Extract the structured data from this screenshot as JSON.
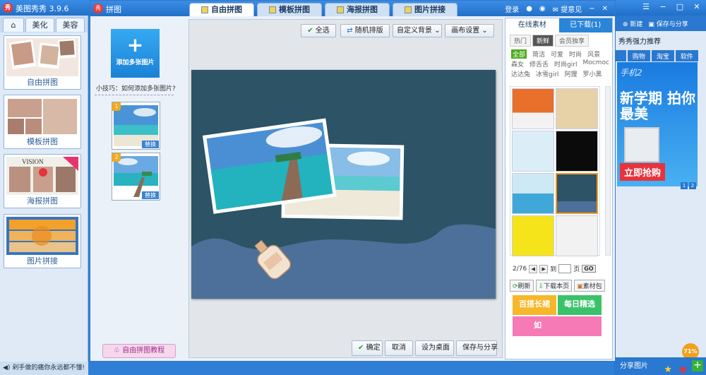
{
  "main_window": {
    "title": "美图秀秀 3.9.6",
    "logo": "秀",
    "status_left": "剁手做的痛你永远都不懂!",
    "left_tabs": [
      "美化",
      "美容"
    ],
    "modes": [
      {
        "label": "自由拼图"
      },
      {
        "label": "模板拼图"
      },
      {
        "label": "海报拼图"
      },
      {
        "label": "图片拼接"
      }
    ],
    "right_toolbar": {
      "new": "新建",
      "save": "保存与分享"
    },
    "ad": {
      "title": "秀秀强力推荐",
      "tabs": [
        "购物",
        "淘宝",
        "软件"
      ],
      "banner_top": "手机2",
      "banner_big": "新学期 拍你最美",
      "banner_cta": "立即抢购",
      "pages": [
        "1",
        "2"
      ]
    },
    "right_status": "分享图片",
    "progress": "71%"
  },
  "dialog": {
    "logo": "秀",
    "title": "拼图",
    "tabs": [
      {
        "label": "自由拼图"
      },
      {
        "label": "模板拼图"
      },
      {
        "label": "海报拼图"
      },
      {
        "label": "图片拼接"
      }
    ],
    "login": "登录",
    "feedback": "提意见",
    "add_button": "添加多张图片",
    "add_plus": "+",
    "tip": "小技巧：如何添加多张图片?",
    "slots": [
      {
        "num": "1",
        "replace": "替换"
      },
      {
        "num": "2",
        "replace": "替换"
      }
    ],
    "tutorial": "自由拼图教程",
    "toolbar": {
      "select_all": "全选",
      "random": "随机排版",
      "custom_bg": "自定义背景",
      "canvas_settings": "画布设置"
    },
    "bottom": {
      "confirm": "确定",
      "cancel": "取消",
      "set_desktop": "设为桌面",
      "save_share": "保存与分享"
    },
    "materials": {
      "tabs": [
        "在线素材",
        "已下载(1)"
      ],
      "sub_tabs": [
        "热门",
        "新鲜",
        "会员独享"
      ],
      "categories": [
        "全部",
        "简洁",
        "可爱",
        "时尚",
        "风景",
        "森女",
        "修舌舌",
        "时尚girl",
        "Mocmoc",
        "达达兔",
        "冰雪girl",
        "阿狸",
        "罗小黑"
      ],
      "pager": {
        "current": "2/76",
        "to": "到",
        "page": "页",
        "go": "GO"
      },
      "actions": [
        "刷新",
        "下载本页",
        "素材包"
      ],
      "promos": [
        "百搭长裙",
        "每日精选",
        "如"
      ]
    }
  },
  "colors": {
    "titlebar": "#2a78cf",
    "poster_bg": "#2c5366",
    "wave": "#4c7099",
    "accent_orange": "#f39a1a"
  }
}
